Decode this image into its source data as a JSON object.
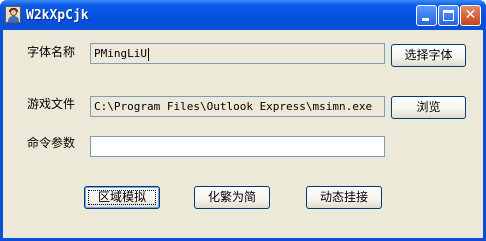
{
  "window": {
    "title": "W2kXpCjk",
    "icon": "user-avatar-icon",
    "close_glyph": "✕"
  },
  "form": {
    "font_label": "字体名称",
    "font_value": "PMingLiU",
    "choose_font_button": "选择字体",
    "game_file_label": "游戏文件",
    "game_file_value": "C:\\Program Files\\Outlook Express\\msimn.exe",
    "browse_button": "浏览",
    "cmd_args_label": "命令参数",
    "cmd_args_value": ""
  },
  "actions": {
    "region_emulate": "区域模拟",
    "trad_to_simp": "化繁为简",
    "dynamic_hook": "动态挂接"
  },
  "colors": {
    "titlebar": "#0a5ae8",
    "dialog_bg": "#ece9d8",
    "close_button": "#c8431f"
  }
}
